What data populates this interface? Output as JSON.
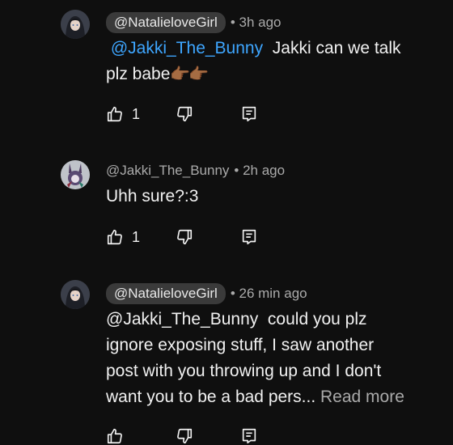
{
  "comments": [
    {
      "author": "@NatalieloveGirl",
      "author_style": "pill",
      "time": "• 3h ago",
      "mention": "@Jakki_The_Bunny",
      "text_line1_after_mention": "Jakki can we talk",
      "text_line2": "plz babe",
      "emoji": "👉🏾👉🏾",
      "like_count": "1"
    },
    {
      "author": "@Jakki_The_Bunny",
      "author_style": "plain",
      "time": "• 2h ago",
      "text": "Uhh sure?:3",
      "like_count": "1"
    },
    {
      "author": "@NatalieloveGirl",
      "author_style": "pill",
      "time": "• 26 min ago",
      "text_lines": [
        "@Jakki_The_Bunny  could you plz",
        "ignore exposing stuff, I saw another",
        "post with you throwing up and I don't",
        "want you to be a bad pers..."
      ],
      "read_more": "Read more"
    }
  ],
  "icons": {
    "like": "thumbs-up-icon",
    "dislike": "thumbs-down-icon",
    "reply": "reply-comment-icon"
  },
  "colors": {
    "background": "#0f0f0f",
    "mention": "#3ea6ff",
    "muted": "#aaaaaa",
    "pill": "#3a3a3a"
  }
}
